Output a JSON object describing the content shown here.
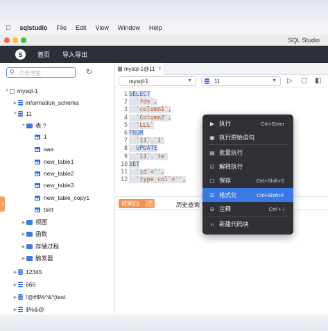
{
  "menubar": {
    "app_name": "sqlstudio",
    "items": [
      "File",
      "Edit",
      "View",
      "Window",
      "Help"
    ]
  },
  "window": {
    "title": "SQL Studio"
  },
  "app_header": {
    "logo_glyph": "S",
    "nav": [
      "首页",
      "导入导出"
    ]
  },
  "sidebar": {
    "search_placeholder": "点击搜索",
    "tree": [
      {
        "label": "mysql-1",
        "icon": "connection-icon",
        "twisty": "▼"
      },
      {
        "label": "information_schema",
        "icon": "database-icon",
        "twisty": "▶"
      },
      {
        "label": "11",
        "icon": "database-icon",
        "twisty": "▼"
      },
      {
        "label": "表 ?",
        "icon": "folder-icon",
        "twisty": "▼"
      },
      {
        "label": "1",
        "icon": "table-icon"
      },
      {
        "label": "aaa",
        "icon": "table-icon"
      },
      {
        "label": "new_table1",
        "icon": "table-icon"
      },
      {
        "label": "new_table2",
        "icon": "table-icon"
      },
      {
        "label": "new_table3",
        "icon": "table-icon"
      },
      {
        "label": "new_table_copy1",
        "icon": "table-icon"
      },
      {
        "label": "tset",
        "icon": "table-icon"
      },
      {
        "label": "视图",
        "icon": "folder-icon",
        "twisty": "▶"
      },
      {
        "label": "函数",
        "icon": "folder-icon",
        "twisty": "▶"
      },
      {
        "label": "存储过程",
        "icon": "folder-icon",
        "twisty": "▶"
      },
      {
        "label": "触发器",
        "icon": "folder-icon",
        "twisty": "▶"
      },
      {
        "label": "12345",
        "icon": "database-icon",
        "twisty": "▶"
      },
      {
        "label": "666",
        "icon": "database-icon",
        "twisty": "▶"
      },
      {
        "label": "!@#$%^&*(test",
        "icon": "database-icon",
        "twisty": "▶"
      },
      {
        "label": "$%&@",
        "icon": "database-icon",
        "twisty": "▶"
      },
      {
        "label": "@W.N",
        "icon": "database-icon",
        "twisty": "▶"
      }
    ]
  },
  "tab": {
    "label": "mysql-1@11",
    "close": "×"
  },
  "toolbar": {
    "connection": "mysql-1",
    "database": "11"
  },
  "editor": {
    "lines": [
      {
        "n": "1",
        "text": "SELECT"
      },
      {
        "n": "2",
        "text": "  `fds`,"
      },
      {
        "n": "3",
        "text": "  `column1`,"
      },
      {
        "n": "4",
        "text": "  `Column2`,"
      },
      {
        "n": "5",
        "text": "  `LLL`"
      },
      {
        "n": "6",
        "text": "FROM"
      },
      {
        "n": "7",
        "text": "  `11`.`1`"
      },
      {
        "n": "8",
        "text": "  UPDATE"
      },
      {
        "n": "9",
        "text": "  `11`.`te`"
      },
      {
        "n": "10",
        "text": "SET"
      },
      {
        "n": "11",
        "text": "  `id`='',"
      },
      {
        "n": "12",
        "text": "  `type_col`='',"
      }
    ]
  },
  "results": {
    "result_tab": "结果(0)",
    "history_tab": "历史查询"
  },
  "context_menu": {
    "items": [
      {
        "label": "执行",
        "shortcut": "Ctrl+Enter",
        "icon": "play-icon"
      },
      {
        "label": "执行原始语句",
        "shortcut": "",
        "icon": "play-raw-icon"
      },
      {
        "label": "批量执行",
        "shortcut": "",
        "icon": "batch-icon"
      },
      {
        "label": "解释执行",
        "shortcut": "",
        "icon": "explain-icon"
      },
      {
        "label": "保存",
        "shortcut": "Ctrl+Shift+S",
        "icon": "save-icon"
      },
      {
        "label": "格式化",
        "shortcut": "Ctrl+Shift+F",
        "icon": "format-icon"
      },
      {
        "label": "注释",
        "shortcut": "Ctrl + /",
        "icon": "comment-icon"
      },
      {
        "label": "新建代码块",
        "shortcut": "",
        "icon": "code-icon"
      }
    ]
  },
  "colors": {
    "accent": "#3a79e4",
    "header_bg": "#2b3038",
    "result_button": "#f29352"
  }
}
